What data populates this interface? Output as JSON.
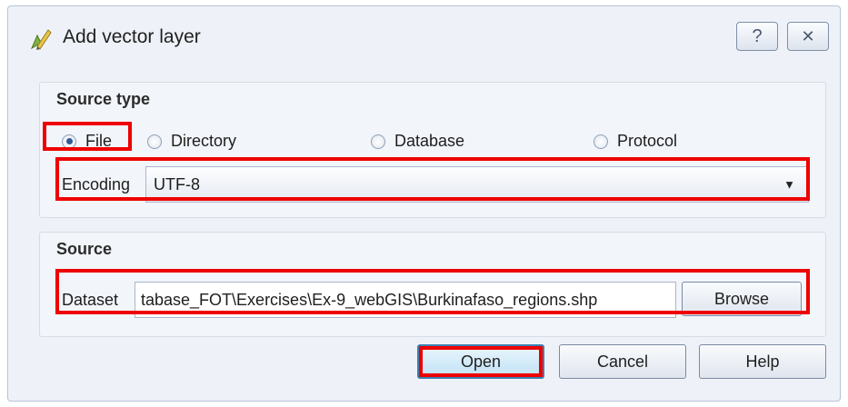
{
  "window": {
    "title": "Add vector layer",
    "help_button": "?",
    "close_button": "✕"
  },
  "source_type": {
    "title": "Source type",
    "options": [
      {
        "label": "File",
        "selected": true
      },
      {
        "label": "Directory",
        "selected": false
      },
      {
        "label": "Database",
        "selected": false
      },
      {
        "label": "Protocol",
        "selected": false
      }
    ],
    "encoding_label": "Encoding",
    "encoding_value": "UTF-8"
  },
  "source": {
    "title": "Source",
    "dataset_label": "Dataset",
    "dataset_value": "tabase_FOT\\Exercises\\Ex-9_webGIS\\Burkinafaso_regions.shp",
    "browse_label": "Browse"
  },
  "buttons": {
    "open": "Open",
    "cancel": "Cancel",
    "help": "Help"
  },
  "colors": {
    "highlight": "#ee0000",
    "dialog_bg": "#eef2f8",
    "default_button_border": "#3c7fb1"
  },
  "icons": {
    "app": "qgis-vector-layer-icon",
    "combo_arrow": "chevron-down-icon"
  }
}
